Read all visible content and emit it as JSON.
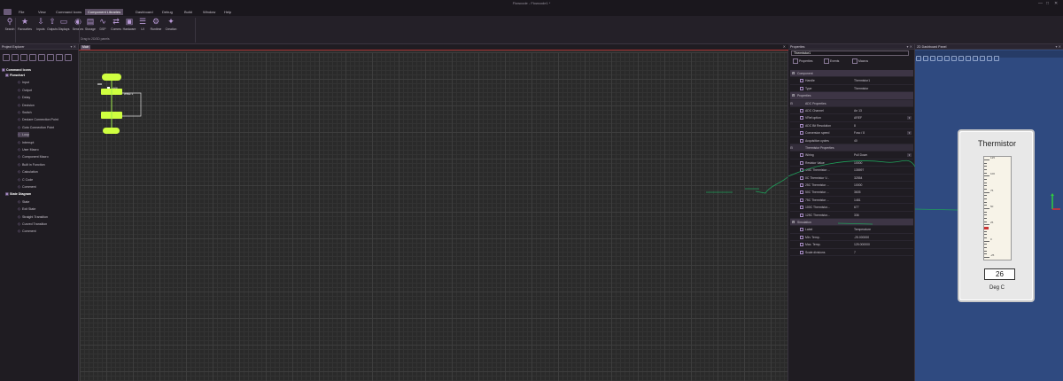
{
  "window": {
    "title": "Flowcode - Flowcode1 *",
    "controls": [
      "—",
      "□",
      "✕"
    ]
  },
  "menu": [
    "File",
    "View",
    "Command Icons",
    "Component Libraries",
    "Dashboard",
    "Debug",
    "Build",
    "Window",
    "Help"
  ],
  "menu_active": 3,
  "ribbon": {
    "buttons": [
      {
        "label": "Search",
        "icon": "search-icon",
        "glyph": "⚲"
      },
      {
        "label": "Favourites",
        "icon": "star-icon",
        "glyph": "★"
      },
      {
        "label": "Inputs",
        "icon": "input-icon",
        "glyph": "⇩"
      },
      {
        "label": "Outputs",
        "icon": "output-icon",
        "glyph": "⇧"
      },
      {
        "label": "Displays",
        "icon": "display-icon",
        "glyph": "▭"
      },
      {
        "label": "Sensors",
        "icon": "sensor-icon",
        "glyph": "◉"
      },
      {
        "label": "Storage",
        "icon": "storage-icon",
        "glyph": "▤"
      },
      {
        "label": "DSP",
        "icon": "dsp-icon",
        "glyph": "∿"
      },
      {
        "label": "Comms",
        "icon": "comms-icon",
        "glyph": "⇄"
      },
      {
        "label": "Hardware",
        "icon": "hardware-icon",
        "glyph": "▣"
      },
      {
        "label": "UI",
        "icon": "ui-icon",
        "glyph": "☰"
      },
      {
        "label": "Runtime",
        "icon": "runtime-icon",
        "glyph": "⚙"
      },
      {
        "label": "Creation",
        "icon": "creation-icon",
        "glyph": "✦"
      }
    ],
    "note": "Drag to 2D/3D panels"
  },
  "explorer": {
    "title": "Project Explorer",
    "root": "Command Icons",
    "items": [
      {
        "label": "Flowchart",
        "level": 1,
        "head": true
      },
      {
        "label": "Input",
        "level": 2
      },
      {
        "label": "Output",
        "level": 2
      },
      {
        "label": "Delay",
        "level": 2
      },
      {
        "label": "Decision",
        "level": 2
      },
      {
        "label": "Switch",
        "level": 2
      },
      {
        "label": "Declare Connection Point",
        "level": 2
      },
      {
        "label": "Goto Connection Point",
        "level": 2
      },
      {
        "label": "Loop",
        "level": 2,
        "sel": true
      },
      {
        "label": "Interrupt",
        "level": 2
      },
      {
        "label": "User Macro",
        "level": 2
      },
      {
        "label": "Component Macro",
        "level": 2
      },
      {
        "label": "Built in Function",
        "level": 2
      },
      {
        "label": "Calculation",
        "level": 2
      },
      {
        "label": "C Code",
        "level": 2
      },
      {
        "label": "Comment",
        "level": 2
      },
      {
        "label": "State Diagram",
        "level": 1,
        "head": true
      },
      {
        "label": "State",
        "level": 2
      },
      {
        "label": "Exit State",
        "level": 2
      },
      {
        "label": "Straight Transition",
        "level": 2
      },
      {
        "label": "Curved Transition",
        "level": 2
      },
      {
        "label": "Comment",
        "level": 2
      }
    ]
  },
  "canvas": {
    "tab": "Main",
    "loop_label": "Loop",
    "loop_cond": "While 1"
  },
  "properties": {
    "title": "Properties",
    "name": "Thermistor1",
    "tabs": [
      "Properties",
      "Events",
      "Macros"
    ],
    "rows": [
      {
        "t": "sec",
        "k": "Component"
      },
      {
        "k": "Handle",
        "v": "Thermistor1"
      },
      {
        "k": "Type",
        "v": "Thermistor"
      },
      {
        "t": "sec",
        "k": "Properties"
      },
      {
        "t": "cat",
        "k": "ADC Properties"
      },
      {
        "k": "ADC Channel",
        "v": "An 13"
      },
      {
        "k": "VRef option",
        "v": "AREF",
        "dd": true
      },
      {
        "k": "ADC Bit Resolution",
        "v": "8"
      },
      {
        "k": "Conversion speed",
        "v": "Fosc / 8",
        "dd": true
      },
      {
        "k": "Acquisition cycles",
        "v": "40"
      },
      {
        "t": "cat",
        "k": "Thermistor Properties"
      },
      {
        "k": "Wiring",
        "v": "Pull Down",
        "dd": true
      },
      {
        "k": "Resistor Value",
        "v": "10000"
      },
      {
        "k": "-25C Thermistor ...",
        "v": "135597"
      },
      {
        "k": "0C Thermistor V...",
        "v": "32554"
      },
      {
        "k": "25C Thermistor ...",
        "v": "10000"
      },
      {
        "k": "50C Thermistor ...",
        "v": "3605"
      },
      {
        "k": "75C Thermistor ...",
        "v": "1481"
      },
      {
        "k": "100C Thermistor...",
        "v": "677"
      },
      {
        "k": "125C Thermistor...",
        "v": "336"
      },
      {
        "t": "sec",
        "k": "Simulation"
      },
      {
        "k": "Label",
        "v": "Temperature"
      },
      {
        "k": "Min. Temp.",
        "v": "-25.000000"
      },
      {
        "k": "Max. Temp.",
        "v": "125.000000"
      },
      {
        "k": "Scale divisions",
        "v": "7"
      }
    ]
  },
  "dashboard": {
    "title": "2D Dashboard Panel",
    "thermistor": {
      "name": "Thermistor",
      "value": "26",
      "unit": "Deg C",
      "ticks": [
        "125",
        "100",
        "75",
        "50",
        "25",
        "0",
        "-25"
      ]
    }
  }
}
